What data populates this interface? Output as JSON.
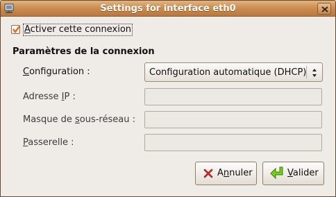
{
  "window": {
    "title": "Settings for interface eth0",
    "icons": {
      "app": "network-icon",
      "close": "close-icon"
    }
  },
  "enable_connection": {
    "label_accel": "A",
    "label_rest": "ctiver cette connexion",
    "checked": true
  },
  "section": {
    "title": "Paramètres de la connexion"
  },
  "fields": {
    "configuration": {
      "label_accel": "C",
      "label_rest": "onfiguration :",
      "value": "Configuration automatique (DHCP)"
    },
    "ip": {
      "label_before": "Adresse ",
      "label_accel": "I",
      "label_after": "P :",
      "value": ""
    },
    "mask": {
      "label_before": "Masque de ",
      "label_accel": "s",
      "label_after": "ous-réseau :",
      "value": ""
    },
    "gateway": {
      "label_accel": "P",
      "label_rest": "asserelle :",
      "value": ""
    }
  },
  "buttons": {
    "cancel": {
      "label_before": "A",
      "label_accel": "n",
      "label_after": "nuler",
      "icon": "cancel-x-icon"
    },
    "ok": {
      "label_accel": "V",
      "label_rest": "alider",
      "icon": "green-arrow-icon"
    }
  },
  "colors": {
    "titlebar": "#cb8f52",
    "background": "#efebe7",
    "checkmark": "#e0701a",
    "ok_arrow": "#4e9a06"
  }
}
